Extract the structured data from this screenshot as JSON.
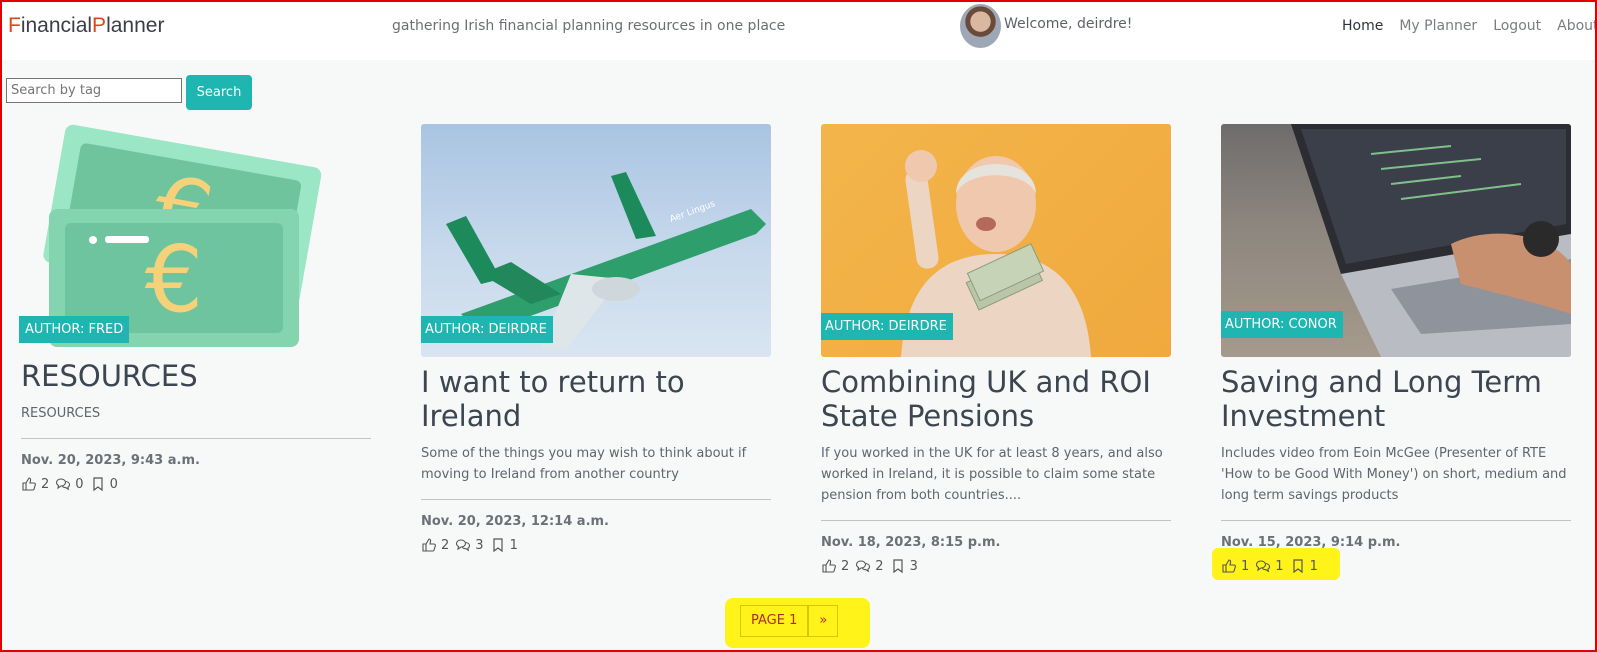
{
  "navbar": {
    "brand_f": "F",
    "brand_inancial": "inancial",
    "brand_p": "P",
    "brand_lanner": "lanner",
    "tagline": "gathering Irish financial planning resources in one place",
    "welcome": "Welcome, deirdre!",
    "links": [
      "Home",
      "My Planner",
      "Logout",
      "About"
    ],
    "active_link": "Home"
  },
  "search": {
    "placeholder": "Search by tag",
    "button_label": "Search"
  },
  "cards": [
    {
      "author": "AUTHOR: FRED",
      "title": "RESOURCES",
      "excerpt": "RESOURCES",
      "date": "Nov. 20, 2023, 9:43 a.m.",
      "likes": "2",
      "comments": "0",
      "bookmarks": "0",
      "image": "euro-banknotes-illustration"
    },
    {
      "author": "AUTHOR: DEIRDRE",
      "title": "I want to return to Ireland",
      "excerpt": "Some of the things you may wish to think about if moving to Ireland from another country",
      "date": "Nov. 20, 2023, 12:14 a.m.",
      "likes": "2",
      "comments": "3",
      "bookmarks": "1",
      "image": "aer-lingus-plane-photo"
    },
    {
      "author": "AUTHOR: DEIRDRE",
      "title": "Combining UK and ROI State Pensions",
      "excerpt": "If you worked in the UK for at least 8 years, and also worked in Ireland, it is possible to claim some state pension from both countries....",
      "date": "Nov. 18, 2023, 8:15 p.m.",
      "likes": "2",
      "comments": "2",
      "bookmarks": "3",
      "image": "woman-holding-cash-photo"
    },
    {
      "author": "AUTHOR: CONOR",
      "title": "Saving and Long Term Investment",
      "excerpt": "Includes video from Eoin McGee (Presenter of RTE 'How to be Good With Money') on short, medium and long term savings products",
      "date": "Nov. 15, 2023, 9:14 p.m.",
      "likes": "1",
      "comments": "1",
      "bookmarks": "1",
      "image": "laptop-typing-photo"
    }
  ],
  "pagination": {
    "current": "PAGE 1",
    "next": "»"
  },
  "colors": {
    "accent": "#1fb5b0",
    "brand_red": "#e0441f",
    "highlight": "#fff200",
    "frame": "#e00000"
  }
}
